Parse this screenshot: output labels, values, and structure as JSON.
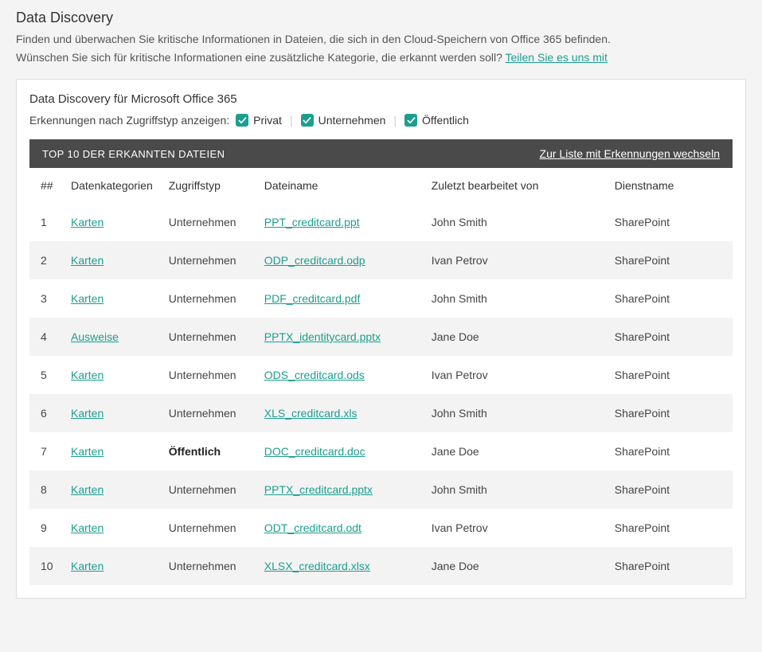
{
  "header": {
    "title": "Data Discovery",
    "desc_line1": "Finden und überwachen Sie kritische Informationen in Dateien, die sich in den Cloud-Speichern von Office 365 befinden.",
    "desc_line2_prefix": "Wünschen Sie sich für kritische Informationen eine zusätzliche Kategorie, die erkannt werden soll? ",
    "desc_line2_link": "Teilen Sie es uns mit"
  },
  "panel": {
    "title": "Data Discovery für Microsoft Office 365",
    "filter_label": "Erkennungen nach Zugriffstyp anzeigen:",
    "filters": {
      "privat": "Privat",
      "unternehmen": "Unternehmen",
      "oeffentlich": "Öffentlich"
    },
    "table_bar": {
      "title": "TOP 10 DER ERKANNTEN DATEIEN",
      "link": "Zur Liste mit Erkennungen wechseln"
    },
    "columns": {
      "idx": "##",
      "category": "Datenkategorien",
      "access": "Zugriffstyp",
      "filename": "Dateiname",
      "edited_by": "Zuletzt bearbeitet von",
      "service": "Dienstname"
    },
    "rows": [
      {
        "idx": "1",
        "category": "Karten",
        "access": "Unternehmen",
        "access_bold": false,
        "filename": "PPT_creditcard.ppt",
        "edited_by": "John Smith",
        "service": "SharePoint"
      },
      {
        "idx": "2",
        "category": "Karten",
        "access": "Unternehmen",
        "access_bold": false,
        "filename": "ODP_creditcard.odp",
        "edited_by": "Ivan Petrov",
        "service": "SharePoint"
      },
      {
        "idx": "3",
        "category": "Karten",
        "access": "Unternehmen",
        "access_bold": false,
        "filename": "PDF_creditcard.pdf",
        "edited_by": "John Smith",
        "service": "SharePoint"
      },
      {
        "idx": "4",
        "category": "Ausweise",
        "access": "Unternehmen",
        "access_bold": false,
        "filename": "PPTX_identitycard.pptx",
        "edited_by": "Jane Doe",
        "service": "SharePoint"
      },
      {
        "idx": "5",
        "category": "Karten",
        "access": "Unternehmen",
        "access_bold": false,
        "filename": "ODS_creditcard.ods",
        "edited_by": "Ivan Petrov",
        "service": "SharePoint"
      },
      {
        "idx": "6",
        "category": "Karten",
        "access": "Unternehmen",
        "access_bold": false,
        "filename": "XLS_creditcard.xls",
        "edited_by": "John Smith",
        "service": "SharePoint"
      },
      {
        "idx": "7",
        "category": "Karten",
        "access": "Öffentlich",
        "access_bold": true,
        "filename": "DOC_creditcard.doc",
        "edited_by": "Jane Doe",
        "service": "SharePoint"
      },
      {
        "idx": "8",
        "category": "Karten",
        "access": "Unternehmen",
        "access_bold": false,
        "filename": "PPTX_creditcard.pptx",
        "edited_by": "John Smith",
        "service": "SharePoint"
      },
      {
        "idx": "9",
        "category": "Karten",
        "access": "Unternehmen",
        "access_bold": false,
        "filename": "ODT_creditcard.odt",
        "edited_by": "Ivan Petrov",
        "service": "SharePoint"
      },
      {
        "idx": "10",
        "category": "Karten",
        "access": "Unternehmen",
        "access_bold": false,
        "filename": "XLSX_creditcard.xlsx",
        "edited_by": "Jane Doe",
        "service": "SharePoint"
      }
    ]
  }
}
